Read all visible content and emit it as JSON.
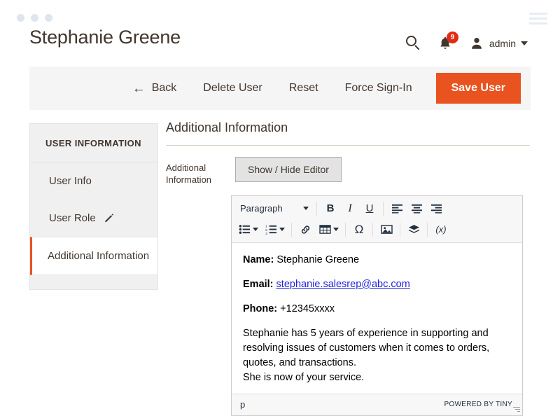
{
  "window": {
    "dots_count": 3,
    "menu_icon": "hamburger-icon"
  },
  "header": {
    "title": "Stephanie Greene",
    "search_icon": "search-icon",
    "notifications": {
      "icon": "bell-icon",
      "count": "9"
    },
    "user": {
      "avatar_icon": "user-avatar-icon",
      "name": "admin",
      "caret": "chevron-down-icon"
    }
  },
  "action_bar": {
    "back": {
      "label": "Back",
      "icon": "arrow-left-icon",
      "glyph": "←"
    },
    "delete_user": "Delete User",
    "reset": "Reset",
    "force_sign_in": "Force Sign-In",
    "save_user": "Save User",
    "primary_color": "#e8531f"
  },
  "sidebar": {
    "title": "USER INFORMATION",
    "items": [
      {
        "label": "User Info",
        "icon": null,
        "active": false
      },
      {
        "label": "User Role",
        "icon": "pencil-icon",
        "glyph": "✎",
        "active": false
      },
      {
        "label": "Additional Information",
        "icon": null,
        "active": true
      }
    ],
    "active_marker_color": "#e8531f"
  },
  "main": {
    "section_title": "Additional Information",
    "field_label": "Additional Information",
    "toggle_button": "Show / Hide Editor"
  },
  "editor": {
    "toolbar": {
      "format_select": {
        "value": "Paragraph",
        "caret": "chevron-down-icon"
      },
      "row1": [
        {
          "name": "bold-icon",
          "glyph": "B"
        },
        {
          "name": "italic-icon",
          "glyph": "I"
        },
        {
          "name": "underline-icon",
          "glyph": "U"
        },
        {
          "name": "align-left-icon",
          "glyph": ""
        },
        {
          "name": "align-center-icon",
          "glyph": ""
        },
        {
          "name": "align-right-icon",
          "glyph": ""
        }
      ],
      "row2": [
        {
          "name": "bullet-list-icon",
          "glyph": ""
        },
        {
          "name": "numbered-list-icon",
          "glyph": ""
        },
        {
          "name": "link-icon",
          "glyph": "🔗"
        },
        {
          "name": "table-icon",
          "glyph": ""
        },
        {
          "name": "special-character-icon",
          "glyph": "Ω"
        },
        {
          "name": "image-icon",
          "glyph": ""
        },
        {
          "name": "template-icon",
          "glyph": ""
        },
        {
          "name": "variable-icon",
          "glyph": "(x)"
        }
      ]
    },
    "content": {
      "name_label": "Name:",
      "name_value": "Stephanie Greene",
      "email_label": "Email:",
      "email_value": "stephanie.salesrep@abc.com",
      "phone_label": "Phone:",
      "phone_value": "+12345xxxx",
      "bio": "Stephanie has 5 years of experience in supporting and resolving issues of customers when it comes to orders, quotes, and transactions.",
      "bio2": "She is now of your service."
    },
    "status": {
      "element_path": "p",
      "brand": "POWERED BY TINY",
      "resize_handle": "resize-grip-icon"
    }
  }
}
